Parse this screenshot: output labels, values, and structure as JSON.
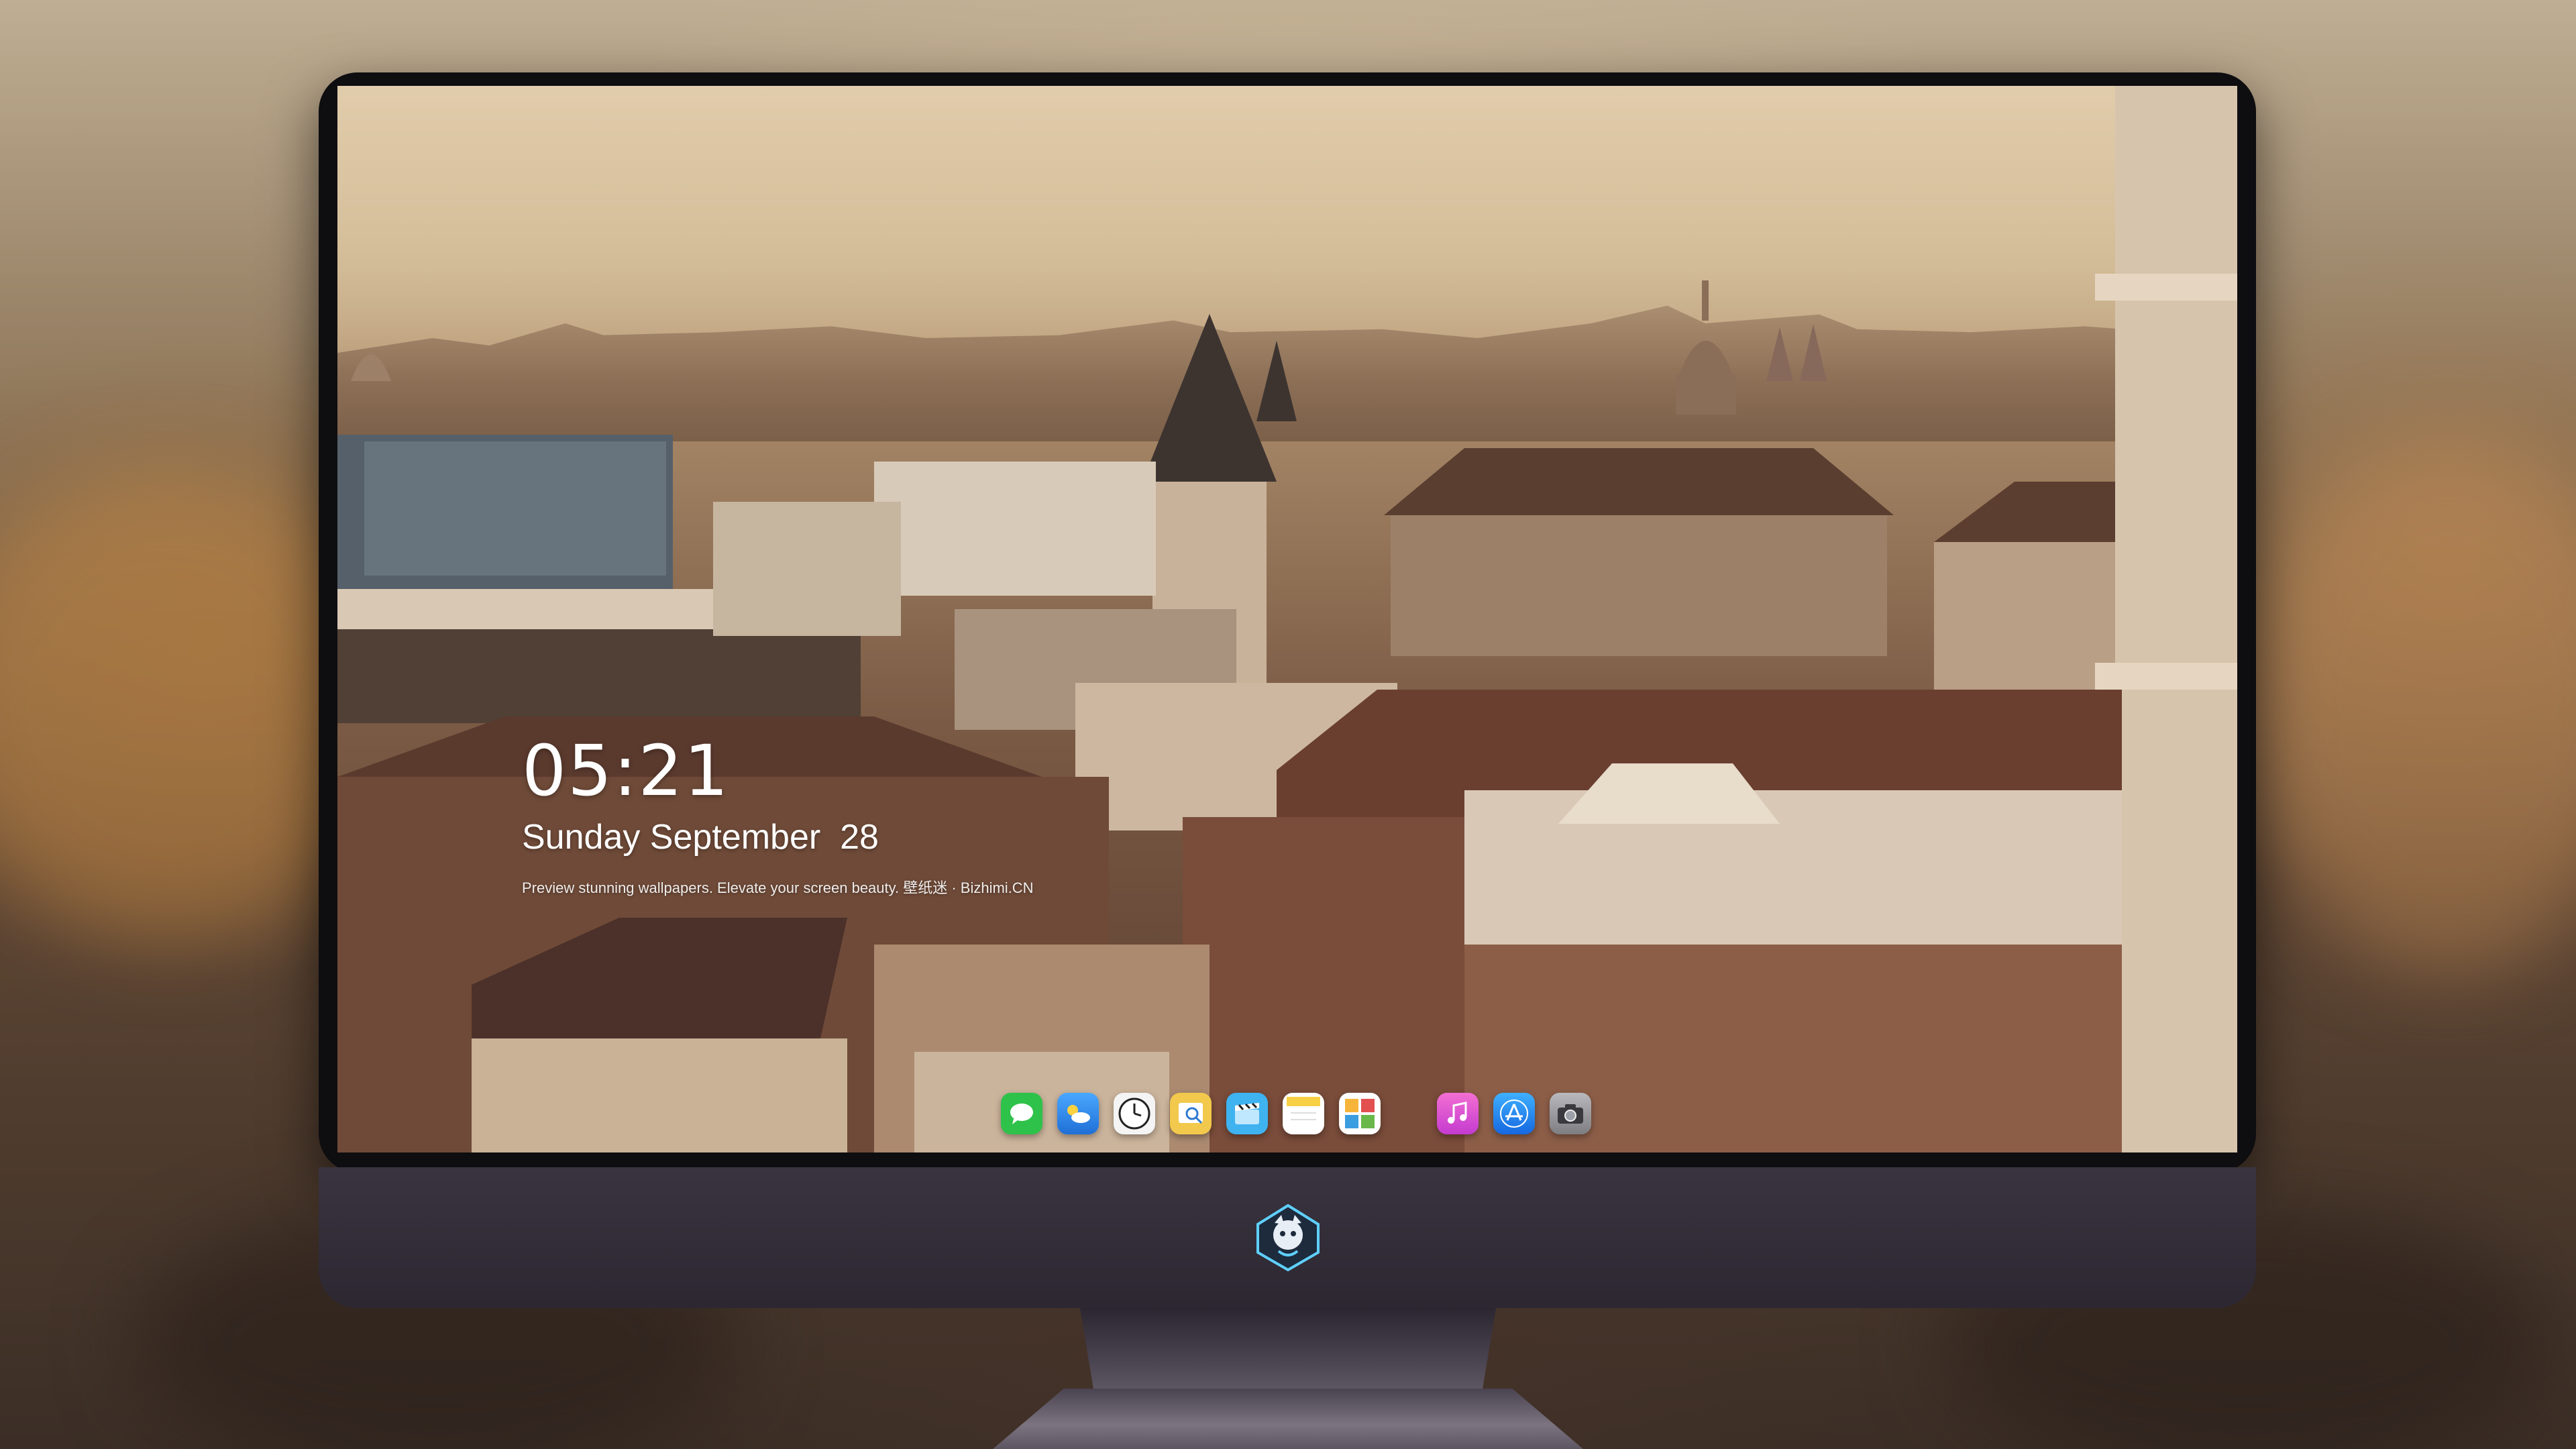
{
  "lockscreen": {
    "time": "05:21",
    "date": "Sunday September  28",
    "tagline": "Preview stunning wallpapers. Elevate your screen beauty. 壁纸迷 · Bizhimi.CN"
  },
  "dock": {
    "items": [
      {
        "name": "messages-icon",
        "color": "#2fc24a"
      },
      {
        "name": "weather-icon",
        "color": "#2e8ef0"
      },
      {
        "name": "clock-icon",
        "color": "#f4f4f4"
      },
      {
        "name": "preview-icon",
        "color": "#f2c94c"
      },
      {
        "name": "clips-icon",
        "color": "#3fb2f0"
      },
      {
        "name": "notes-icon",
        "color": "#f7d046"
      },
      {
        "name": "photo-gallery-icon",
        "color": "#6ab84a"
      },
      {
        "name": "music-icon",
        "color": "#e04fd9"
      },
      {
        "name": "app-store-icon",
        "color": "#1f8cf5"
      },
      {
        "name": "camera-icon",
        "color": "#9a9a9e"
      }
    ]
  },
  "brand": {
    "logo_name": "bizhimi-mascot-logo"
  }
}
